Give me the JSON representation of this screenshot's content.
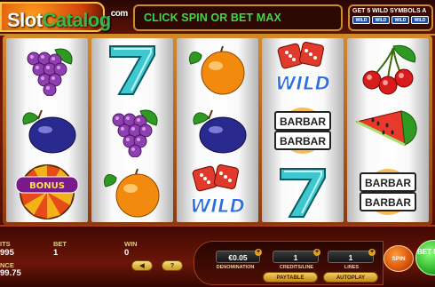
{
  "header": {
    "watermark": {
      "part1": "Slot",
      "part2": "Catalog",
      "part3": "com"
    },
    "message": "CLICK SPIN OR BET MAX",
    "promo_text": "GET 5 WILD SYMBOLS A",
    "promo_icon_label": "WILD"
  },
  "reels": [
    [
      "grapes",
      "plum",
      "bonus"
    ],
    [
      "seven",
      "grapes",
      "orange"
    ],
    [
      "orange",
      "plum",
      "wild-dice"
    ],
    [
      "wild-dice",
      "bar-bar",
      "seven"
    ],
    [
      "cherries",
      "watermelon",
      "bar-bar"
    ]
  ],
  "symbols": {
    "wild_label": "WILD",
    "bar_label": "BAR",
    "bonus_label": "BONUS"
  },
  "stats": {
    "credits_label": "ITS",
    "credits_value": "995",
    "bet_label": "BET",
    "bet_value": "1",
    "win_label": "WIN",
    "win_value": "0",
    "balance_label": "NCE",
    "balance_value": "99.75"
  },
  "controls": {
    "denomination_value": "€0.05",
    "denomination_label": "DENOMINATION",
    "credits_line_value": "1",
    "credits_line_label": "CREDITS/LINE",
    "lines_value": "1",
    "lines_label": "LINES",
    "paytable_label": "PAYTABLE",
    "autoplay_label": "AUTOPLAY",
    "spin_label": "SPIN",
    "max_label": "BET MAX",
    "prev_label": "◀",
    "next_label": "?"
  },
  "colors": {
    "message_green": "#3fd64a",
    "accent_gold": "#c98d2b",
    "wild_blue": "#2c6fe0"
  }
}
